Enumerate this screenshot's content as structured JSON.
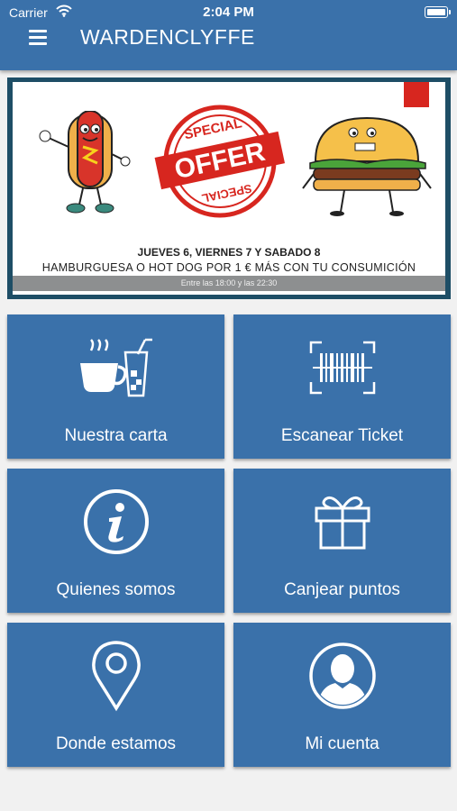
{
  "status_bar": {
    "carrier": "Carrier",
    "time": "2:04 PM"
  },
  "header": {
    "title": "WARDENCLYFFE"
  },
  "banner": {
    "stamp_text_top": "SPECIAL",
    "stamp_text_main": "OFFER",
    "stamp_text_bottom": "SPECIAL",
    "line1": "JUEVES 6, VIERNES 7 Y SABADO 8",
    "line2": "HAMBURGUESA O HOT DOG POR 1 € MÁS CON TU CONSUMICIÓN",
    "line3": "Entre las 18:00 y las 22:30"
  },
  "tiles": [
    {
      "label": "Nuestra carta",
      "icon": "coffee-drink-icon"
    },
    {
      "label": "Escanear Ticket",
      "icon": "barcode-scan-icon"
    },
    {
      "label": "Quienes somos",
      "icon": "info-icon"
    },
    {
      "label": "Canjear puntos",
      "icon": "gift-icon"
    },
    {
      "label": "Donde estamos",
      "icon": "location-pin-icon"
    },
    {
      "label": "Mi cuenta",
      "icon": "user-avatar-icon"
    }
  ],
  "colors": {
    "primary": "#3a71aa",
    "background": "#f1f1f1",
    "stamp_red": "#d7261f"
  }
}
